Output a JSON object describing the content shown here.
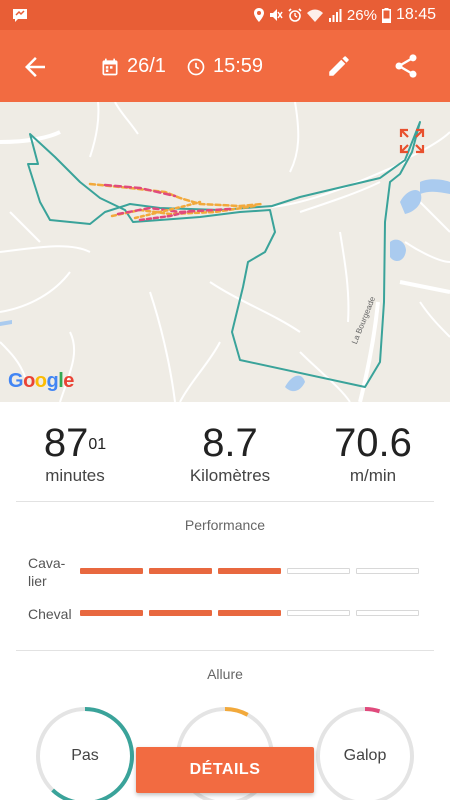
{
  "status_bar": {
    "battery": "26%",
    "time": "18:45",
    "icons": [
      "message-icon",
      "location-icon",
      "mute-icon",
      "alarm-icon",
      "wifi-icon",
      "signal-icon",
      "battery-icon"
    ]
  },
  "app_bar": {
    "date": "26/1",
    "time": "15:59",
    "icons": [
      "back-arrow-icon",
      "calendar-icon",
      "clock-icon",
      "edit-icon",
      "share-icon"
    ],
    "color": "#f26b41"
  },
  "map": {
    "provider_logo": "Google",
    "road_label": "La Bourgeade",
    "route_color": "#3aa39a",
    "icons": [
      "expand-icon",
      "add-photo-icon"
    ]
  },
  "stats": [
    {
      "value": "87",
      "sup": "01",
      "label": "minutes"
    },
    {
      "value": "8.7",
      "label": "Kilomètres"
    },
    {
      "value": "70.6",
      "label": "m/min"
    }
  ],
  "performance": {
    "title": "Performance",
    "rows": [
      {
        "label_line1": "Cava-",
        "label_line2": "lier",
        "level": 3,
        "max": 5
      },
      {
        "label_line1": "Cheval",
        "label_line2": "",
        "level": 3,
        "max": 5
      }
    ]
  },
  "allure": {
    "title": "Allure",
    "gauges": [
      {
        "label": "Pas",
        "fraction": 0.62,
        "color": "#3aa39a"
      },
      {
        "label": "",
        "fraction": 0.08,
        "color": "#f2a93b"
      },
      {
        "label": "Galop",
        "fraction": 0.05,
        "color": "#e04a7c"
      }
    ]
  },
  "details_button": {
    "label": "DÉTAILS"
  }
}
